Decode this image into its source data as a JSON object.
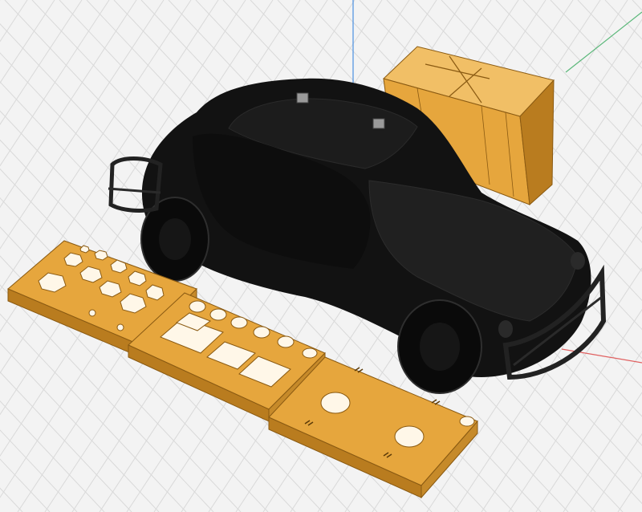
{
  "viewport": {
    "background": "#f3f3f3",
    "grid_color": "#d9d9d9",
    "axis_colors": {
      "x": "#e06060",
      "y": "#5bb87a",
      "z": "#4a90e2"
    }
  },
  "scene": {
    "objects": [
      {
        "name": "beetle-car-body",
        "color": "#121212"
      },
      {
        "name": "storage-box",
        "color": "#e6a63d"
      },
      {
        "name": "hex-bit-tray",
        "color": "#e6a63d"
      },
      {
        "name": "round-slot-tray",
        "color": "#e6a63d"
      },
      {
        "name": "clip-plate",
        "color": "#e6a63d"
      }
    ]
  },
  "colors": {
    "part_orange": "#e6a63d",
    "part_orange_dark": "#b97c1f",
    "part_orange_light": "#f1bf66",
    "car_black": "#121212"
  }
}
